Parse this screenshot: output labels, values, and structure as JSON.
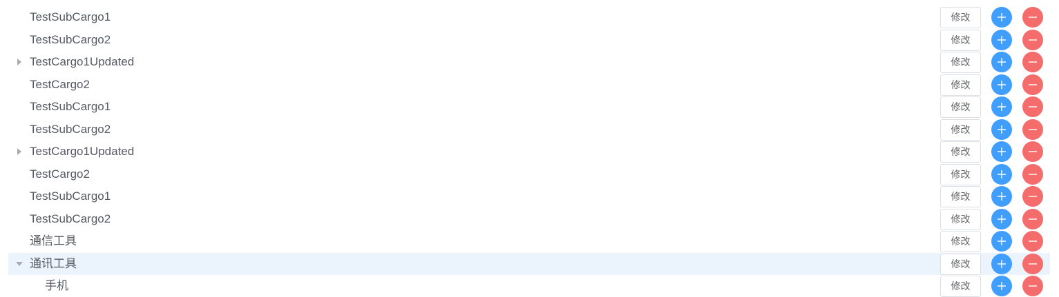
{
  "tree": {
    "edit_label": "修改",
    "add_icon": "plus-icon",
    "delete_icon": "minus-icon",
    "colors": {
      "add": "#409eff",
      "delete": "#f56c6c",
      "highlight": "#ebf3fd"
    },
    "rows": [
      {
        "label": "TestSubCargo1",
        "expander": "none",
        "indent": 0
      },
      {
        "label": "TestSubCargo2",
        "expander": "none",
        "indent": 0
      },
      {
        "label": "TestCargo1Updated",
        "expander": "collapsed",
        "indent": 0
      },
      {
        "label": "TestCargo2",
        "expander": "none",
        "indent": 0
      },
      {
        "label": "TestSubCargo1",
        "expander": "none",
        "indent": 0
      },
      {
        "label": "TestSubCargo2",
        "expander": "none",
        "indent": 0
      },
      {
        "label": "TestCargo1Updated",
        "expander": "collapsed",
        "indent": 0
      },
      {
        "label": "TestCargo2",
        "expander": "none",
        "indent": 0
      },
      {
        "label": "TestSubCargo1",
        "expander": "none",
        "indent": 0
      },
      {
        "label": "TestSubCargo2",
        "expander": "none",
        "indent": 0
      },
      {
        "label": "通信工具",
        "expander": "none",
        "indent": 0
      },
      {
        "label": "通讯工具",
        "expander": "expanded",
        "indent": 0,
        "highlighted": true
      },
      {
        "label": "手机",
        "expander": "none",
        "indent": 1
      }
    ]
  }
}
